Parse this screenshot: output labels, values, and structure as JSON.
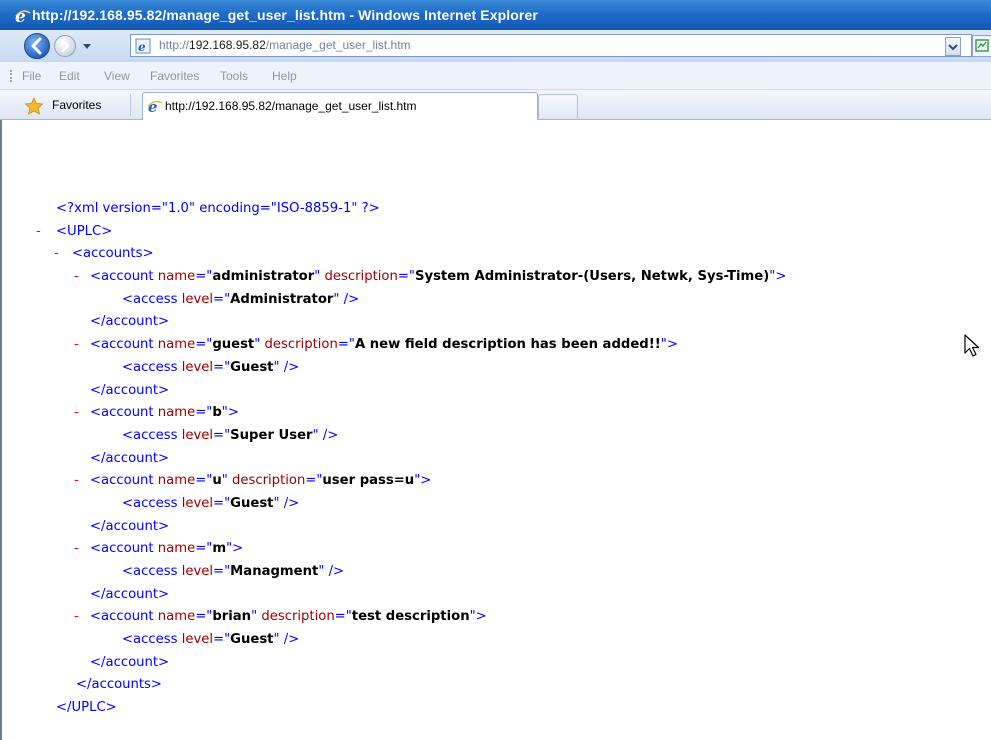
{
  "window": {
    "title": "http://192.168.95.82/manage_get_user_list.htm - Windows Internet Explorer"
  },
  "address_bar": {
    "url_prefix": "http://",
    "url_host": "192.168.95.82",
    "url_path": "/manage_get_user_list.htm"
  },
  "menu": [
    "File",
    "Edit",
    "View",
    "Favorites",
    "Tools",
    "Help"
  ],
  "favorites_label": "Favorites",
  "tab": {
    "label": "http://192.168.95.82/manage_get_user_list.htm"
  },
  "xml": {
    "declaration": "<?xml version=\"1.0\" encoding=\"ISO-8859-1\" ?>",
    "root_open": "<UPLC>",
    "accounts_open": "<accounts>",
    "accounts": [
      {
        "name": "administrator",
        "description": "System Administrator-(Users, Netwk, Sys-Time)",
        "level": "Administrator"
      },
      {
        "name": "guest",
        "description": "A new field description has been added!!",
        "level": "Guest"
      },
      {
        "name": "b",
        "description": null,
        "level": "Super User"
      },
      {
        "name": "u",
        "description": "user pass=u",
        "level": "Guest"
      },
      {
        "name": "m",
        "description": null,
        "level": "Managment"
      },
      {
        "name": "brian",
        "description": "test description",
        "level": "Guest"
      }
    ],
    "account_close": "</account>",
    "accounts_close": "</accounts>",
    "root_close": "</UPLC>",
    "collapse_marker": "-"
  },
  "icons": {
    "ie": "internet-explorer-icon",
    "back": "back-arrow-icon",
    "forward": "forward-arrow-icon",
    "star": "favorites-star-icon",
    "cursor": "mouse-pointer-icon"
  },
  "colors": {
    "title_bar": "#1e6cc9",
    "xml_markup": "#0000ff",
    "xml_attr_name": "#990000",
    "xml_value": "#000000",
    "collapse_marker": "#ff0000"
  }
}
